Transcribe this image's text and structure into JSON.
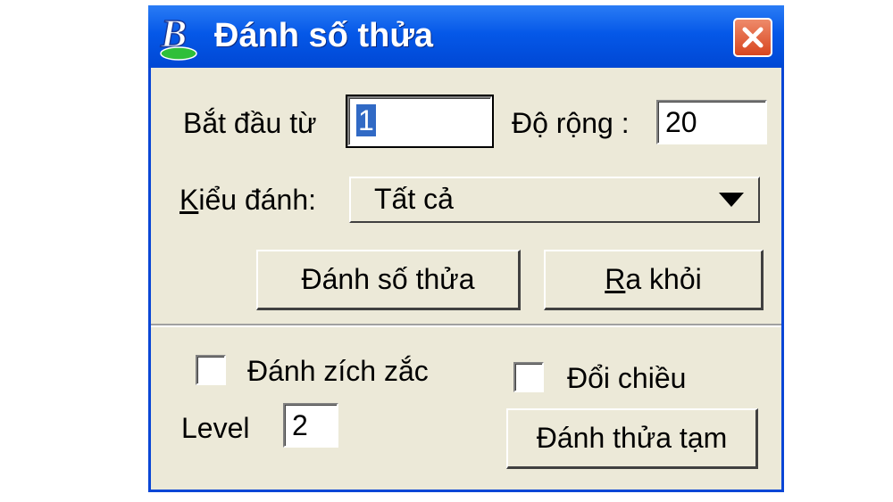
{
  "dialog": {
    "title": "Đánh số thửa",
    "app_icon": "letter-b-app-icon",
    "close_icon": "close-x-icon",
    "accent_color": "#0a46d6"
  },
  "start": {
    "label": "Bắt đầu từ",
    "value": "1"
  },
  "width": {
    "label": "Độ rộng :",
    "value": "20"
  },
  "numbering_type": {
    "label_prefix": "K",
    "label_rest": "iểu đánh:",
    "selected": "Tất cả",
    "dropdown_icon": "triangle-down-icon"
  },
  "buttons": {
    "number_parcels": "Đánh số thửa",
    "exit_mnemonic": "R",
    "exit_rest": "a khỏi",
    "temp_number": "Đánh thửa tạm"
  },
  "options": {
    "zigzag": {
      "label": "Đánh zích zắc",
      "checked": false
    },
    "reverse": {
      "label": "Đổi chiều",
      "checked": false
    }
  },
  "level": {
    "label": "Level",
    "value": "2"
  }
}
